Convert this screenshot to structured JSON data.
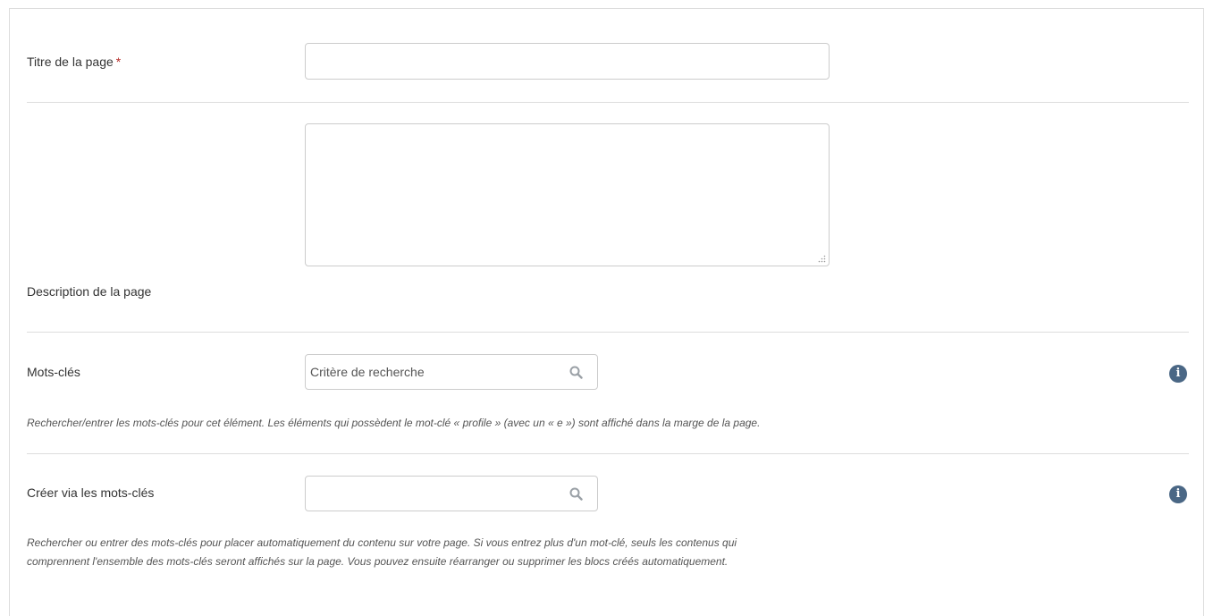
{
  "fields": {
    "title": {
      "label": "Titre de la page",
      "required_mark": "*",
      "value": ""
    },
    "description": {
      "label": "Description de la page",
      "value": ""
    },
    "tags": {
      "label": "Mots-clés",
      "placeholder": "Critère de recherche",
      "help": "Rechercher/entrer les mots-clés pour cet élément. Les éléments qui possèdent le mot-clé « profile » (avec un « e ») sont affiché dans la marge de la page."
    },
    "create_by_tags": {
      "label": "Créer via les mots-clés",
      "value": "",
      "help_line1": "Rechercher ou entrer des mots-clés pour placer automatiquement du contenu sur votre page. Si vous entrez plus d'un mot-clé, seuls les contenus qui",
      "help_line2": "comprennent l'ensemble des mots-clés seront affichés sur la page. Vous pouvez ensuite réarranger ou supprimer les blocs créés automatiquement."
    }
  },
  "icons": {
    "info": "info-icon",
    "search": "search-icon"
  },
  "colors": {
    "required": "#b52b27",
    "info_icon": "#4a6785",
    "border": "#cccccc",
    "divider": "#dddddd"
  }
}
